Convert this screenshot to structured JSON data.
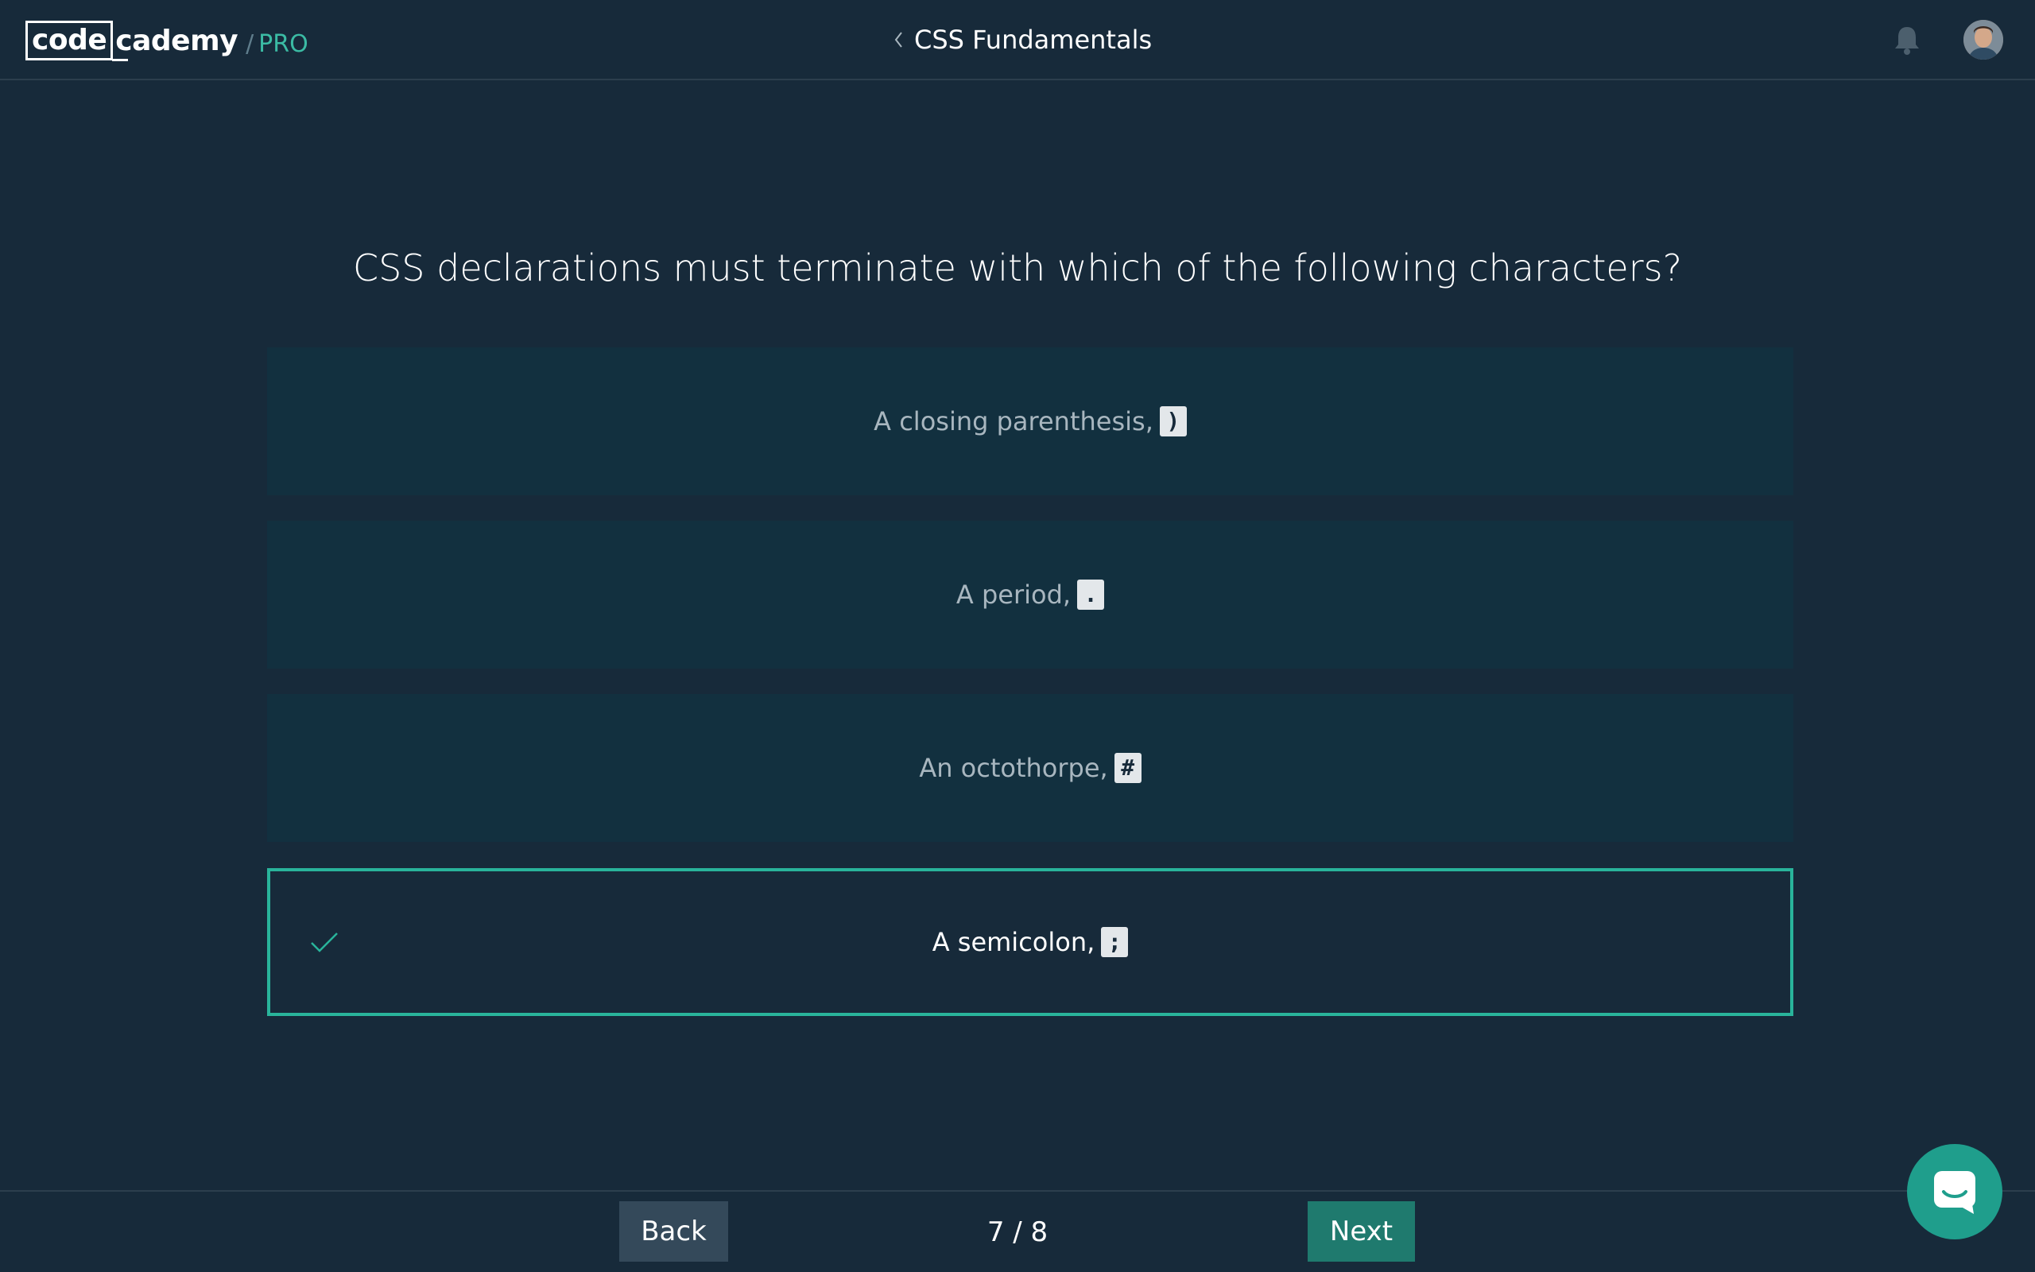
{
  "header": {
    "logo_code": "code",
    "logo_rest": "cademy",
    "logo_slash": "/",
    "logo_pro": "PRO",
    "course_title": "CSS Fundamentals"
  },
  "quiz": {
    "question": "CSS declarations must terminate with which of the following characters?",
    "options": [
      {
        "label": "A closing parenthesis,",
        "code": ")",
        "selected": false
      },
      {
        "label": "A period,",
        "code": ".",
        "selected": false
      },
      {
        "label": "An octothorpe,",
        "code": "#",
        "selected": false
      },
      {
        "label": "A semicolon,",
        "code": ";",
        "selected": true
      }
    ]
  },
  "footer": {
    "back_label": "Back",
    "next_label": "Next",
    "progress": "7 / 8"
  },
  "colors": {
    "background": "#172a3a",
    "option_bg": "#12303f",
    "accent": "#29b49b",
    "pro": "#3bbba4",
    "next_button": "#1f7a6e",
    "back_button": "#34495a"
  },
  "icons": {
    "back": "chevron-left-icon",
    "notifications": "bell-icon",
    "correct": "checkmark-icon",
    "chat": "chat-icon"
  }
}
